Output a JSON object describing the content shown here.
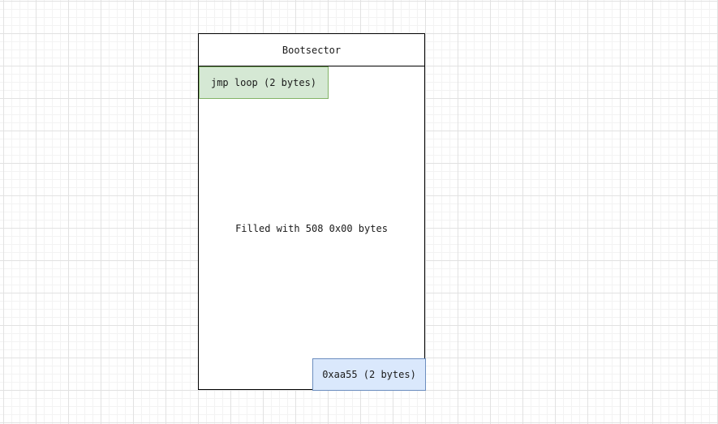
{
  "diagram": {
    "title": "Bootsector",
    "jmp_block": {
      "label": "jmp loop (2 bytes)",
      "fill_color": "#d5e8d4",
      "stroke_color": "#82b366"
    },
    "fill_block": {
      "label": "Filled with 508 0x00 bytes"
    },
    "signature_block": {
      "label": "0xaa55 (2 bytes)",
      "fill_color": "#dae8fc",
      "stroke_color": "#6c8ebf"
    }
  }
}
